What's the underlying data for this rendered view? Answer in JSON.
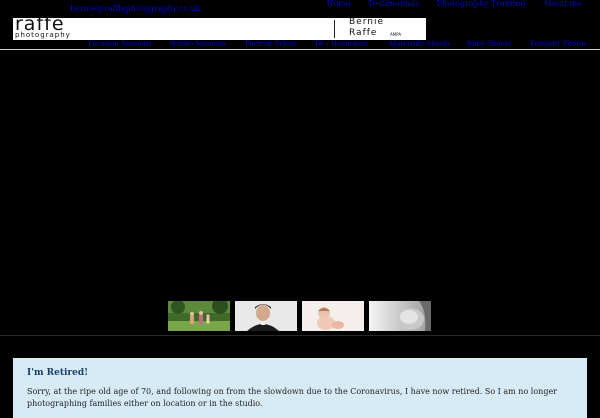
{
  "header": {
    "email": "bernie@rafflephotography.co.uk",
    "top_nav": [
      "Home",
      "Testimonials",
      "Photography Training",
      "About me"
    ]
  },
  "logo": {
    "brand_main": "raffe",
    "brand_sub": "photography",
    "name_first": "Bernie",
    "name_last": "Raffe",
    "credentials": "AMPA"
  },
  "main_nav": [
    "Location Sessions",
    "Studio Sessions",
    "Portrait Prices",
    "TR / Headshots",
    "Maternity Shoots",
    "Baby Shoots",
    "Passport Photos"
  ],
  "thumbnails": [
    {
      "label": "family-outdoor-photo"
    },
    {
      "label": "man-portrait-photo"
    },
    {
      "label": "baby-studio-photo"
    },
    {
      "label": "maternity-bw-photo"
    }
  ],
  "notice": {
    "title": "I'm Retired!",
    "body": "Sorry, at the ripe old age of 70, and following on from the slowdown due to the Coronavirus, I have now retired. So I am no longer photographing families either on location or in the studio."
  },
  "colors": {
    "background": "#000000",
    "link": "#0000cc",
    "notice_bg": "#d7ebf6",
    "notice_title": "#1a3f66"
  }
}
